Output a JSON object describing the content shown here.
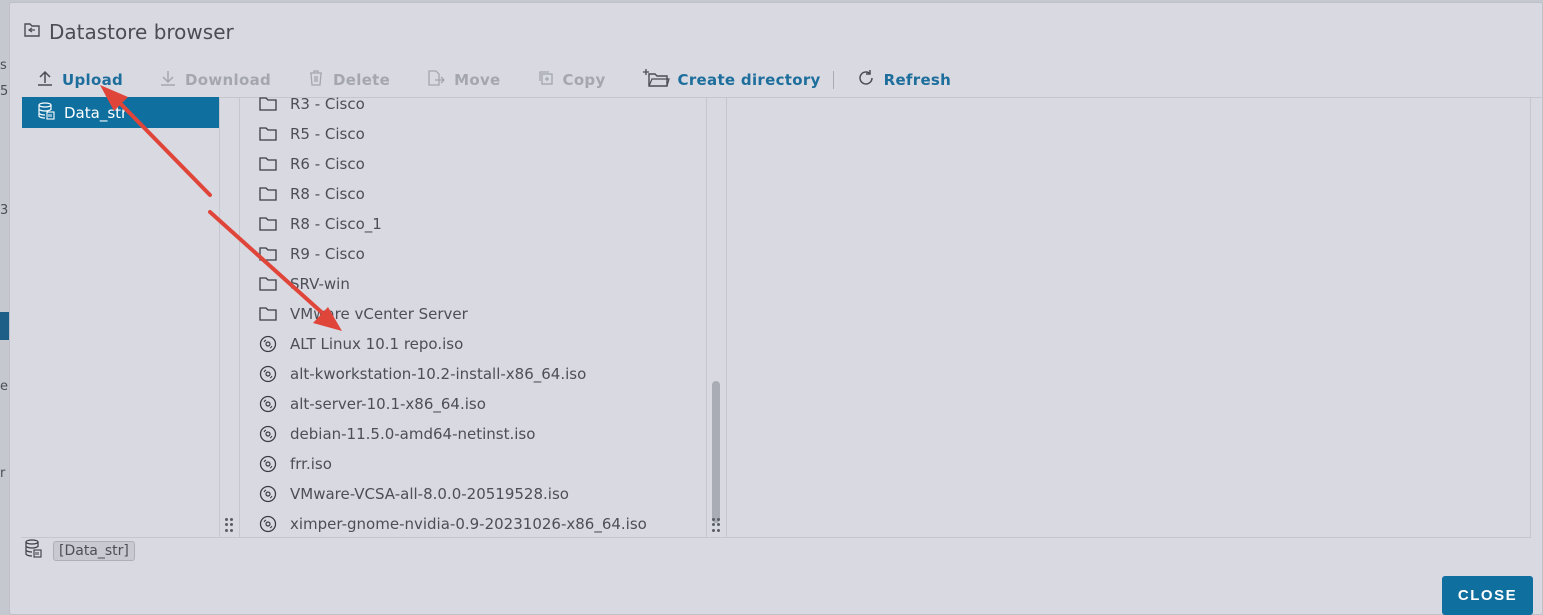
{
  "window": {
    "title": "Datastore browser"
  },
  "toolbar": {
    "upload": "Upload",
    "download": "Download",
    "delete": "Delete",
    "move": "Move",
    "copy": "Copy",
    "create_directory": "Create directory",
    "refresh": "Refresh"
  },
  "tree": {
    "selected": "Data_str"
  },
  "files": [
    {
      "name": "R3 - Cisco",
      "type": "folder"
    },
    {
      "name": "R5 - Cisco",
      "type": "folder"
    },
    {
      "name": "R6 - Cisco",
      "type": "folder"
    },
    {
      "name": "R8 - Cisco",
      "type": "folder"
    },
    {
      "name": "R8 - Cisco_1",
      "type": "folder"
    },
    {
      "name": "R9 - Cisco",
      "type": "folder"
    },
    {
      "name": "SRV-win",
      "type": "folder"
    },
    {
      "name": "VMware vCenter Server",
      "type": "folder"
    },
    {
      "name": "ALT Linux 10.1 repo.iso",
      "type": "disc-image"
    },
    {
      "name": "alt-kworkstation-10.2-install-x86_64.iso",
      "type": "disc-image"
    },
    {
      "name": "alt-server-10.1-x86_64.iso",
      "type": "disc-image"
    },
    {
      "name": "debian-11.5.0-amd64-netinst.iso",
      "type": "disc-image"
    },
    {
      "name": "frr.iso",
      "type": "disc-image"
    },
    {
      "name": "VMware-VCSA-all-8.0.0-20519528.iso",
      "type": "disc-image"
    },
    {
      "name": "ximper-gnome-nvidia-0.9-20231026-x86_64.iso",
      "type": "disc-image"
    }
  ],
  "status": {
    "path": "[Data_str]"
  },
  "footer": {
    "close": "CLOSE"
  },
  "background_fragments": [
    "s",
    "5",
    "3",
    "e",
    "r"
  ],
  "colors": {
    "accent": "#1d6e9c",
    "selected_bg": "#0f6f9f",
    "annotation_arrow": "#e0453a"
  }
}
